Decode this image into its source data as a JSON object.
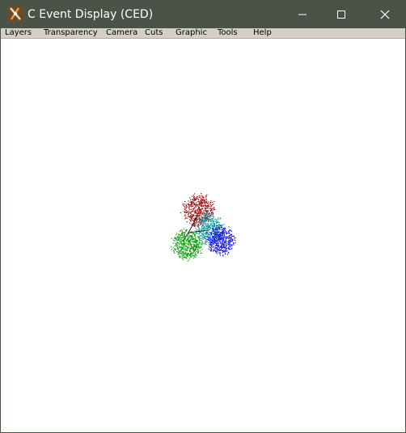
{
  "window": {
    "title": "C Event Display (CED)",
    "titlebar_color": "#4b5349"
  },
  "menu": {
    "items": [
      "Layers",
      "Transparency",
      "Camera",
      "Cuts",
      "Graphic",
      "Tools",
      "Help"
    ]
  },
  "display": {
    "background": "#ffffff",
    "clusters": [
      {
        "color_name": "red",
        "color": "#9b1010"
      },
      {
        "color_name": "cyan",
        "color": "#0a9aa0"
      },
      {
        "color_name": "blue",
        "color": "#1010e0"
      },
      {
        "color_name": "green",
        "color": "#10a010"
      }
    ]
  }
}
